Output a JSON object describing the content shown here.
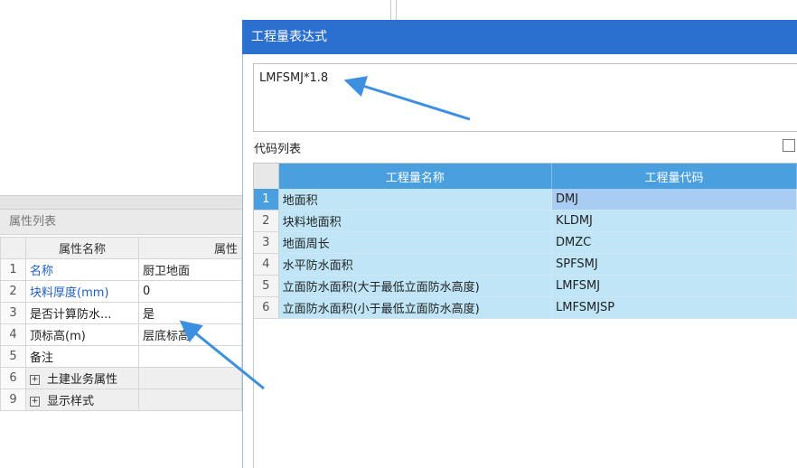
{
  "left_panel": {
    "title": "属性列表",
    "headers": {
      "name": "属性名称",
      "value": "属性"
    },
    "rows": [
      {
        "num": "1",
        "name": "名称",
        "value": "厨卫地面",
        "blue": true,
        "expand": false,
        "shade": false
      },
      {
        "num": "2",
        "name": "块料厚度(mm)",
        "value": "0",
        "blue": true,
        "expand": false,
        "shade": false
      },
      {
        "num": "3",
        "name": "是否计算防水...",
        "value": "是",
        "blue": false,
        "expand": false,
        "shade": false
      },
      {
        "num": "4",
        "name": "顶标高(m)",
        "value": "层底标高",
        "blue": false,
        "expand": false,
        "shade": false
      },
      {
        "num": "5",
        "name": "备注",
        "value": "",
        "blue": false,
        "expand": false,
        "shade": false
      },
      {
        "num": "6",
        "name": "土建业务属性",
        "value": "",
        "blue": false,
        "expand": true,
        "shade": true
      },
      {
        "num": "9",
        "name": "显示样式",
        "value": "",
        "blue": false,
        "expand": true,
        "shade": true
      }
    ]
  },
  "dialog": {
    "title": "工程量表达式",
    "expression": "LMFSMJ*1.8",
    "code_list_label": "代码列表",
    "table": {
      "headers": {
        "name": "工程量名称",
        "code": "工程量代码"
      },
      "rows": [
        {
          "num": "1",
          "name": "地面积",
          "code": "DMJ",
          "selected": true
        },
        {
          "num": "2",
          "name": "块料地面积",
          "code": "KLDMJ",
          "selected": false
        },
        {
          "num": "3",
          "name": "地面周长",
          "code": "DMZC",
          "selected": false
        },
        {
          "num": "4",
          "name": "水平防水面积",
          "code": "SPFSMJ",
          "selected": false
        },
        {
          "num": "5",
          "name": "立面防水面积(大于最低立面防水高度)",
          "code": "LMFSMJ",
          "selected": false
        },
        {
          "num": "6",
          "name": "立面防水面积(小于最低立面防水高度)",
          "code": "LMFSMJSP",
          "selected": false
        }
      ]
    }
  },
  "annotations": {
    "arrow_color": "#3d8fe0"
  },
  "icons": {
    "expand": "plus-box-icon"
  }
}
